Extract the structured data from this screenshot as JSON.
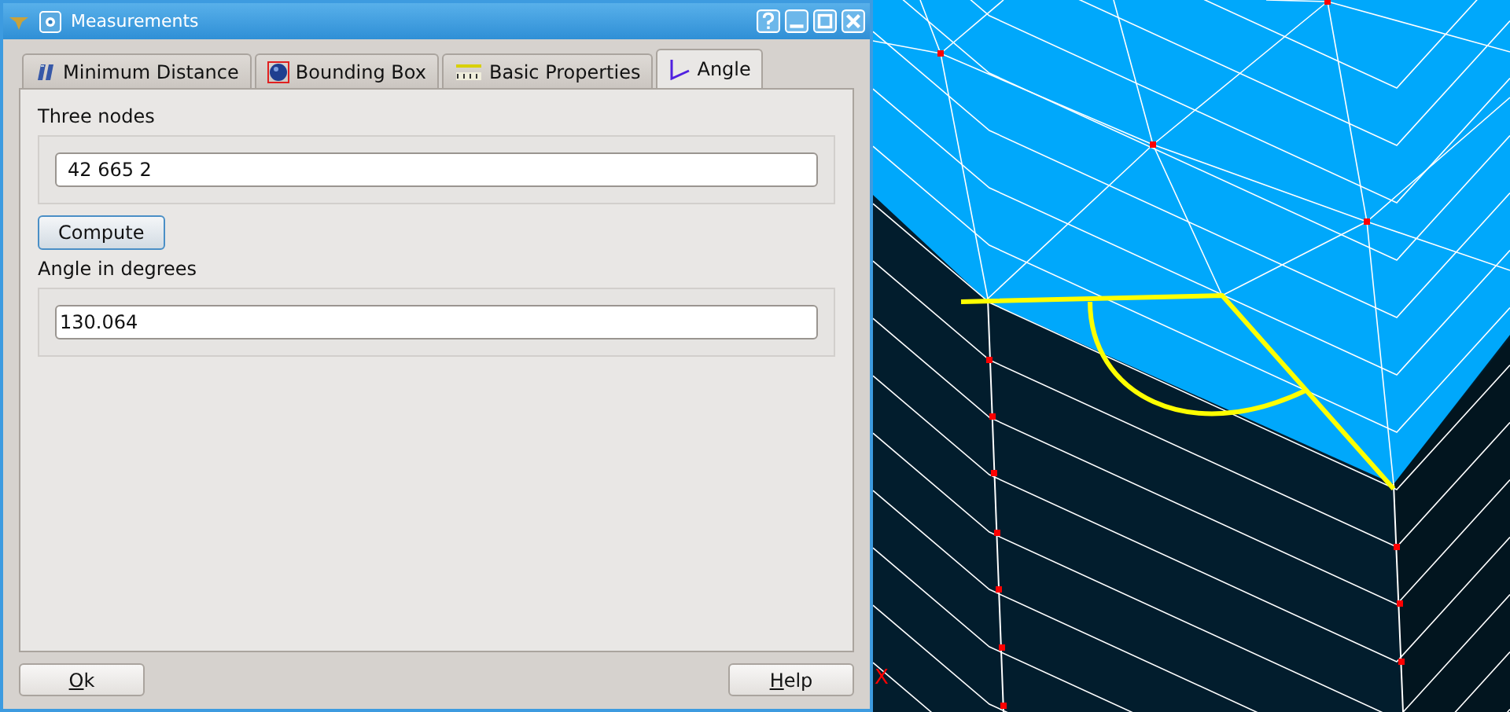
{
  "window": {
    "title": "Measurements"
  },
  "tabs": [
    {
      "label": "Minimum Distance",
      "selected": false,
      "kind": "distance"
    },
    {
      "label": "Bounding Box",
      "selected": false,
      "kind": "box"
    },
    {
      "label": "Basic Properties",
      "selected": false,
      "kind": "properties"
    },
    {
      "label": "Angle",
      "selected": true,
      "kind": "angle"
    }
  ],
  "nodes_group": {
    "label": "Three nodes",
    "value": "42 665 2"
  },
  "compute_button": "Compute",
  "result_group": {
    "label": "Angle in degrees",
    "value": "130.064"
  },
  "buttons": [
    {
      "label": "Ok",
      "underline_first": true
    },
    {
      "label": "Help",
      "underline_first": true
    }
  ],
  "viewport": {
    "axis_label": "X"
  }
}
